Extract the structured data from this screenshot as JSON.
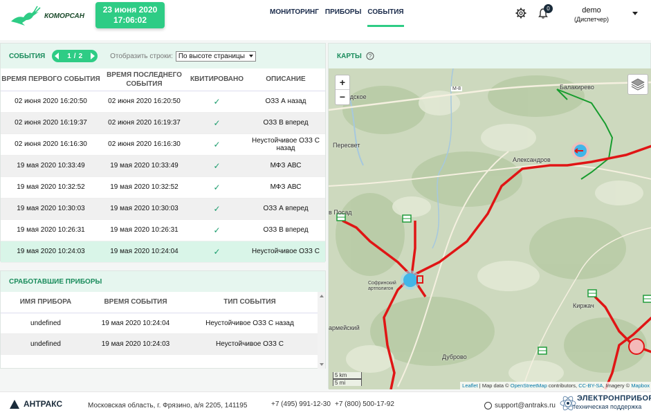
{
  "header": {
    "logo_text": "КОМОРСАН",
    "date": "23 июня 2020",
    "time": "17:06:02",
    "nav": [
      {
        "label": "МОНИТОРИНГ"
      },
      {
        "label": "ПРИБОРЫ"
      },
      {
        "label": "СОБЫТИЯ"
      }
    ],
    "notifications_count": "0",
    "user_name": "demo",
    "user_role": "(Диспетчер)"
  },
  "events": {
    "title": "СОБЫТИЯ",
    "page_current": "1",
    "page_sep": "/",
    "page_total": "2",
    "rows_label": "Отобразить строки:",
    "rows_value": "По высоте страницы",
    "columns": [
      "ВРЕМЯ ПЕРВОГО СОБЫТИЯ",
      "ВРЕМЯ ПОСЛЕДНЕГО СОБЫТИЯ",
      "КВИТИРОВАНО",
      "ОПИСАНИЕ"
    ],
    "rows": [
      {
        "first": "02 июня 2020 16:20:50",
        "last": "02 июня 2020 16:20:50",
        "ack": "✓",
        "desc": "ОЗЗ А назад"
      },
      {
        "first": "02 июня 2020 16:19:37",
        "last": "02 июня 2020 16:19:37",
        "ack": "✓",
        "desc": "ОЗЗ В вперед"
      },
      {
        "first": "02 июня 2020 16:16:30",
        "last": "02 июня 2020 16:16:30",
        "ack": "✓",
        "desc": "Неустойчивое ОЗЗ С назад"
      },
      {
        "first": "19 мая 2020 10:33:49",
        "last": "19 мая 2020 10:33:49",
        "ack": "✓",
        "desc": "МФЗ АВС"
      },
      {
        "first": "19 мая 2020 10:32:52",
        "last": "19 мая 2020 10:32:52",
        "ack": "✓",
        "desc": "МФЗ АВС"
      },
      {
        "first": "19 мая 2020 10:30:03",
        "last": "19 мая 2020 10:30:03",
        "ack": "✓",
        "desc": "ОЗЗ А вперед"
      },
      {
        "first": "19 мая 2020 10:26:31",
        "last": "19 мая 2020 10:26:31",
        "ack": "✓",
        "desc": "ОЗЗ В вперед"
      },
      {
        "first": "19 мая 2020 10:24:03",
        "last": "19 мая 2020 10:24:04",
        "ack": "✓",
        "desc": "Неустойчивое ОЗЗ С"
      }
    ]
  },
  "devices": {
    "title": "СРАБОТАВШИЕ ПРИБОРЫ",
    "columns": [
      "ИМЯ ПРИБОРА",
      "ВРЕМЯ СОБЫТИЯ",
      "ТИП СОБЫТИЯ"
    ],
    "rows": [
      {
        "name": "undefined",
        "time": "19 мая 2020 10:24:04",
        "type": "Неустойчивое ОЗЗ С назад"
      },
      {
        "name": "undefined",
        "time": "19 мая 2020 10:24:03",
        "type": "Неустойчивое ОЗЗ С"
      }
    ]
  },
  "map": {
    "title": "КАРТЫ",
    "zoom_in": "+",
    "zoom_out": "−",
    "scale_km": "5 km",
    "scale_mi": "5 mi",
    "attr_leaflet": "Leaflet",
    "attr_mid": " | Map data © ",
    "attr_osm": "OpenStreetMap",
    "attr_contrib": " contributors, ",
    "attr_cc": "CC-BY-SA",
    "attr_imagery": ", Imagery © ",
    "attr_mapbox": "Mapbox",
    "labels": {
      "balakirevo": "Балакирево",
      "rodskoe": "одское",
      "m8": "М-8",
      "peresvet": "Пересвет",
      "alexandrov": "Александров",
      "posad": "в Посад",
      "sofrinsky": "Софринский артполигон",
      "kirzhach": "Киржач",
      "armeyskiy": "армейский",
      "dubrovo": "Дуброво"
    }
  },
  "footer": {
    "company": "АНТРАКС",
    "address": "Московская область, г. Фрязино, а/я 2205, 141195",
    "phone1": "+7 (495) 991-12-30",
    "phone2": "+7 (800) 500-17-92",
    "email": "support@antraks.ru",
    "brand": "ЭЛЕКТРОНПРИБОР",
    "brand_sub": "техническая поддержка"
  }
}
